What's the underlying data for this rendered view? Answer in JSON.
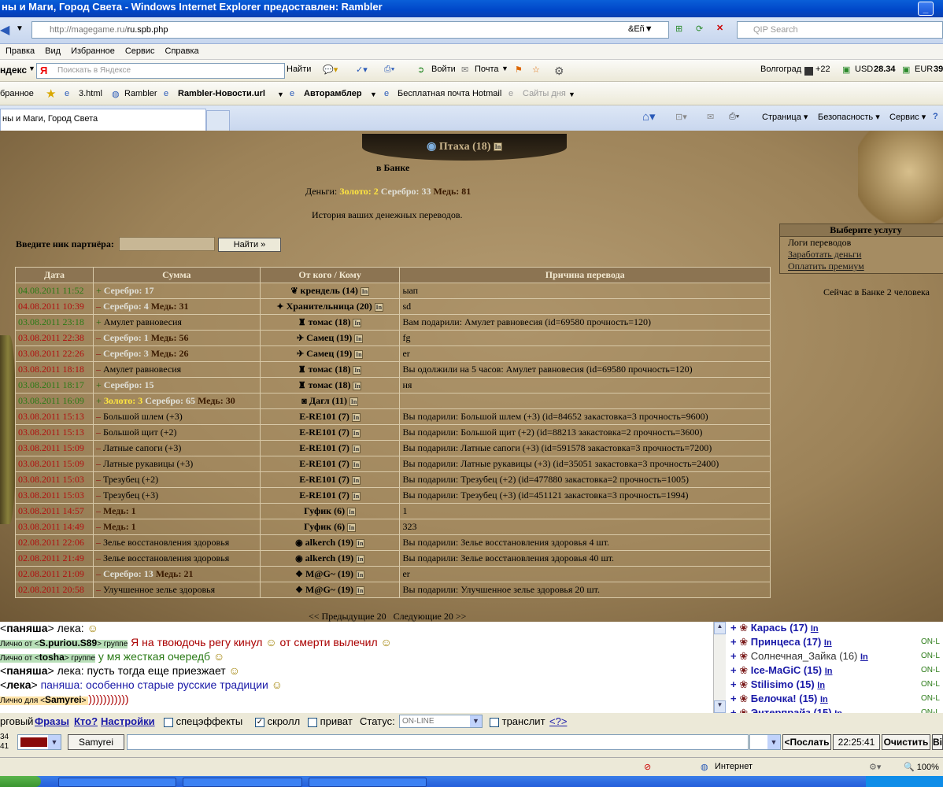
{
  "window": {
    "title": "ны и Маги, Город Света - Windows Internet Explorer предоставлен: Rambler"
  },
  "address": {
    "url_host": "http://magegame.ru/",
    "url_path": "ru.spb.php",
    "search_placeholder": "QIP Search"
  },
  "menu": [
    "Правка",
    "Вид",
    "Избранное",
    "Сервис",
    "Справка"
  ],
  "yandex_bar": {
    "brand": "ндекс",
    "search_placeholder": "Поискать в Яндексе",
    "find": "Найти",
    "login": "Войти",
    "mail": "Почта",
    "city": "Волгоград",
    "temp": "+22",
    "usd_label": "USD",
    "usd": "28.34",
    "eur_label": "EUR",
    "eur": "39"
  },
  "fav_bar": {
    "items": [
      "бранное",
      "3.html",
      "Rambler",
      "Rambler-Новости.url",
      "Авторамблер",
      "Бесплатная почта Hotmail",
      "Сайты дня"
    ]
  },
  "tab": {
    "title": "ны и Маги, Город Света"
  },
  "tools": {
    "page": "Страница",
    "security": "Безопасность",
    "service": "Сервис"
  },
  "game": {
    "char_name": "Птаха (18)",
    "in_bank": "в Банке",
    "money_label": "Деньги:",
    "gold": "Золото: 2",
    "silver": "Серебро: 33",
    "copper": "Медь: 81",
    "history": "История ваших денежных переводов.",
    "partner_label": "Введите ник партнёра:",
    "find_button": "Найти »",
    "services": {
      "header": "Выберите услугу",
      "items": [
        "Логи переводов",
        "Заработать деньги",
        "Оплатить премиум"
      ]
    },
    "now_in_bank": "Сейчас в Банке 2 человека",
    "columns": [
      "Дата",
      "Сумма",
      "От кого / Кому",
      "Причина перевода"
    ],
    "pager_prev": "<< Предыдущие 20",
    "pager_next": "Следующие 20 >>"
  },
  "transactions": [
    {
      "date": "04.08.2011 11:52",
      "dcolor": "green",
      "sign": "+",
      "parts": [
        {
          "t": "Серебро: 17",
          "c": "silver"
        }
      ],
      "icon": "❦",
      "who": "крендель (14)",
      "reason": "ыап"
    },
    {
      "date": "04.08.2011 10:39",
      "dcolor": "red",
      "sign": "–",
      "parts": [
        {
          "t": "Серебро: 4",
          "c": "silver"
        },
        {
          "t": "Медь: 31",
          "c": "copper"
        }
      ],
      "icon": "✦",
      "who": "Хранительница (20)",
      "reason": "sd"
    },
    {
      "date": "03.08.2011 23:18",
      "dcolor": "green",
      "sign": "+",
      "parts": [
        {
          "t": "Амулет равновесия",
          "c": "plain"
        }
      ],
      "icon": "♜",
      "who": "томас (18)",
      "reason": "Вам подарили: Амулет равновесия (id=69580 прочность=120)"
    },
    {
      "date": "03.08.2011 22:38",
      "dcolor": "red",
      "sign": "–",
      "parts": [
        {
          "t": "Серебро: 1",
          "c": "silver"
        },
        {
          "t": "Медь: 56",
          "c": "copper"
        }
      ],
      "icon": "✈",
      "who": "Самец (19)",
      "reason": "fg"
    },
    {
      "date": "03.08.2011 22:26",
      "dcolor": "red",
      "sign": "–",
      "parts": [
        {
          "t": "Серебро: 3",
          "c": "silver"
        },
        {
          "t": "Медь: 26",
          "c": "copper"
        }
      ],
      "icon": "✈",
      "who": "Самец (19)",
      "reason": "er"
    },
    {
      "date": "03.08.2011 18:18",
      "dcolor": "red",
      "sign": "–",
      "parts": [
        {
          "t": "Амулет равновесия",
          "c": "plain"
        }
      ],
      "icon": "♜",
      "who": "томас (18)",
      "reason": "Вы одолжили на 5 часов: Амулет равновесия (id=69580 прочность=120)"
    },
    {
      "date": "03.08.2011 18:17",
      "dcolor": "green",
      "sign": "+",
      "parts": [
        {
          "t": "Серебро: 15",
          "c": "silver"
        }
      ],
      "icon": "♜",
      "who": "томас (18)",
      "reason": "ня"
    },
    {
      "date": "03.08.2011 16:09",
      "dcolor": "green",
      "sign": "+",
      "parts": [
        {
          "t": "Золото: 3",
          "c": "gold"
        },
        {
          "t": "Серебро: 65",
          "c": "silver"
        },
        {
          "t": "Медь: 30",
          "c": "copper"
        }
      ],
      "icon": "◙",
      "who": "Дагл (11)",
      "reason": ""
    },
    {
      "date": "03.08.2011 15:13",
      "dcolor": "red",
      "sign": "–",
      "parts": [
        {
          "t": "Большой шлем (+3)",
          "c": "plain"
        }
      ],
      "icon": "",
      "who": "E-RE101 (7)",
      "reason": "Вы подарили: Большой шлем (+3) (id=84652 закастовка=3 прочность=9600)"
    },
    {
      "date": "03.08.2011 15:13",
      "dcolor": "red",
      "sign": "–",
      "parts": [
        {
          "t": "Большой щит (+2)",
          "c": "plain"
        }
      ],
      "icon": "",
      "who": "E-RE101 (7)",
      "reason": "Вы подарили: Большой щит (+2) (id=88213 закастовка=2 прочность=3600)"
    },
    {
      "date": "03.08.2011 15:09",
      "dcolor": "red",
      "sign": "–",
      "parts": [
        {
          "t": "Латные сапоги (+3)",
          "c": "plain"
        }
      ],
      "icon": "",
      "who": "E-RE101 (7)",
      "reason": "Вы подарили: Латные сапоги (+3) (id=591578 закастовка=3 прочность=7200)"
    },
    {
      "date": "03.08.2011 15:09",
      "dcolor": "red",
      "sign": "–",
      "parts": [
        {
          "t": "Латные рукавицы (+3)",
          "c": "plain"
        }
      ],
      "icon": "",
      "who": "E-RE101 (7)",
      "reason": "Вы подарили: Латные рукавицы (+3) (id=35051 закастовка=3 прочность=2400)"
    },
    {
      "date": "03.08.2011 15:03",
      "dcolor": "red",
      "sign": "–",
      "parts": [
        {
          "t": "Трезубец (+2)",
          "c": "plain"
        }
      ],
      "icon": "",
      "who": "E-RE101 (7)",
      "reason": "Вы подарили: Трезубец (+2) (id=477880 закастовка=2 прочность=1005)"
    },
    {
      "date": "03.08.2011 15:03",
      "dcolor": "red",
      "sign": "–",
      "parts": [
        {
          "t": "Трезубец (+3)",
          "c": "plain"
        }
      ],
      "icon": "",
      "who": "E-RE101 (7)",
      "reason": "Вы подарили: Трезубец (+3) (id=451121 закастовка=3 прочность=1994)"
    },
    {
      "date": "03.08.2011 14:57",
      "dcolor": "red",
      "sign": "–",
      "parts": [
        {
          "t": "Медь: 1",
          "c": "copper"
        }
      ],
      "icon": "",
      "who": "Гуфик (6)",
      "reason": "1"
    },
    {
      "date": "03.08.2011 14:49",
      "dcolor": "red",
      "sign": "–",
      "parts": [
        {
          "t": "Медь: 1",
          "c": "copper"
        }
      ],
      "icon": "",
      "who": "Гуфик (6)",
      "reason": "323"
    },
    {
      "date": "02.08.2011 22:06",
      "dcolor": "red",
      "sign": "–",
      "parts": [
        {
          "t": "Зелье восстановления здоровья",
          "c": "plain"
        }
      ],
      "icon": "◉",
      "who": "alkerch (19)",
      "reason": "Вы подарили: Зелье восстановления здоровья 4 шт."
    },
    {
      "date": "02.08.2011 21:49",
      "dcolor": "red",
      "sign": "–",
      "parts": [
        {
          "t": "Зелье восстановления здоровья",
          "c": "plain"
        }
      ],
      "icon": "◉",
      "who": "alkerch (19)",
      "reason": "Вы подарили: Зелье восстановления здоровья 40 шт."
    },
    {
      "date": "02.08.2011 21:09",
      "dcolor": "red",
      "sign": "–",
      "parts": [
        {
          "t": "Серебро: 13",
          "c": "silver"
        },
        {
          "t": "Медь: 21",
          "c": "copper"
        }
      ],
      "icon": "❖",
      "who": "M@G~ (19)",
      "reason": "er"
    },
    {
      "date": "02.08.2011 20:58",
      "dcolor": "red",
      "sign": "–",
      "parts": [
        {
          "t": "Улучшенное зелье здоровья",
          "c": "plain"
        }
      ],
      "icon": "❖",
      "who": "M@G~ (19)",
      "reason": "Вы подарили: Улучшенное зелье здоровья 20 шт."
    }
  ],
  "chat": [
    {
      "pre": "",
      "tag": "",
      "nick": "паняша",
      "after": "",
      "text": "лека:",
      "smile": true
    },
    {
      "pre": "Лично от",
      "tag": "g",
      "nick": "S.puriou.S89",
      "after": "группе",
      "text": "Я на твоюдочь регу кинул",
      "text2": "от смерти вылечил",
      "smile": true
    },
    {
      "pre": "Лично от",
      "tag": "g",
      "nick": "tosha",
      "after": "группе",
      "text": "у мя жесткая очередб",
      "smile": true
    },
    {
      "pre": "",
      "tag": "",
      "nick": "паняша",
      "after": "",
      "text": "лека: пусть тогда еще приезжает",
      "smile": true
    },
    {
      "pre": "",
      "tag": "",
      "nick": "лека",
      "after": "",
      "text": "паняша: особенно старые русские традиции",
      "smile": true
    },
    {
      "pre": "Лично для",
      "tag": "y",
      "nick": "Samyrei",
      "after": "",
      "text": ")))))))))))",
      "smile": false
    }
  ],
  "online": [
    {
      "name": "Карась (17)",
      "bold": true,
      "status": ""
    },
    {
      "name": "Принцеса (17)",
      "bold": true,
      "status": "ON-L"
    },
    {
      "name": "Солнечная_Зайка (16)",
      "bold": false,
      "status": "ON-L"
    },
    {
      "name": "Ice-MaGiC (15)",
      "bold": true,
      "status": "ON-L"
    },
    {
      "name": "Stilisimo (15)",
      "bold": true,
      "status": "ON-L"
    },
    {
      "name": "Белочка! (15)",
      "bold": true,
      "status": "ON-L"
    },
    {
      "name": "Энтерпрайз (15)",
      "bold": true,
      "status": "ON-L"
    }
  ],
  "chat_controls": {
    "prefix": "рговый",
    "phrases": "Фразы",
    "who": "Кто?",
    "settings": "Настройки",
    "effects": "спецэффекты",
    "scroll": "скролл",
    "private": "приват",
    "status_label": "Статус:",
    "status_value": "ON-LINE",
    "translit": "транслит",
    "help": "<?>"
  },
  "send_row": {
    "clock_top": "34",
    "clock_bottom": "41",
    "nick_button": "Samyrei",
    "send": "<Послать",
    "time": "22:25:41",
    "clear": "Очистить",
    "extra": "Вi"
  },
  "statusbar": {
    "zone": "Интернет",
    "zoom": "100%"
  }
}
